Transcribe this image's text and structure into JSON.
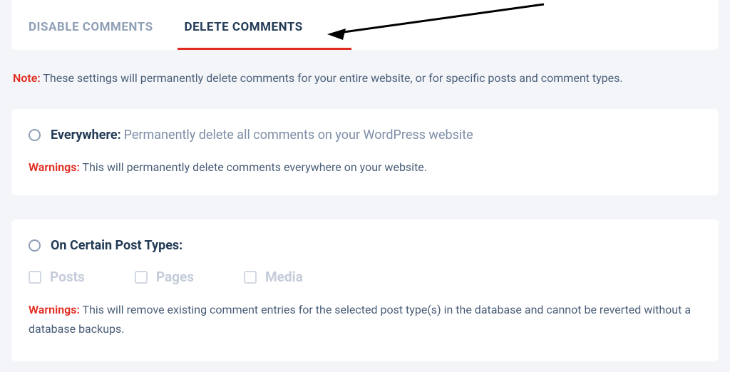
{
  "tabs": {
    "inactive": "DISABLE COMMENTS",
    "active": "DELETE COMMENTS"
  },
  "note": {
    "label": "Note:",
    "text": "These settings will permanently delete comments for your entire website, or for specific posts and comment types."
  },
  "option1": {
    "title": "Everywhere:",
    "desc": "Permanently delete all comments on your WordPress website",
    "warn_label": "Warnings:",
    "warn_text": "This will permanently delete comments everywhere on your website."
  },
  "option2": {
    "title": "On Certain Post Types:",
    "post_types": {
      "posts": "Posts",
      "pages": "Pages",
      "media": "Media"
    },
    "warn_label": "Warnings:",
    "warn_text": "This will remove existing comment entries for the selected post type(s) in the database and cannot be reverted without a database backups."
  }
}
